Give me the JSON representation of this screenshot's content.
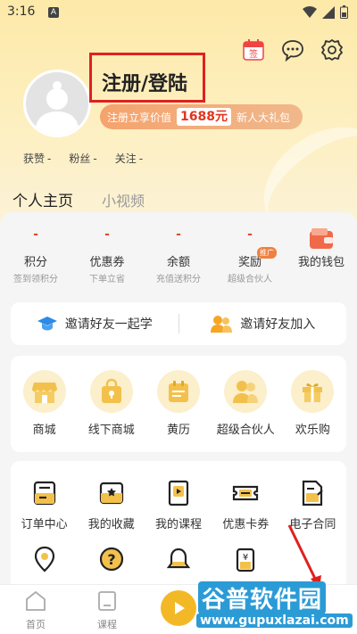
{
  "status_bar": {
    "time": "3:16",
    "notif_letter": "A"
  },
  "header": {
    "calendar_badge": "签",
    "login_title": "注册/登陆",
    "promo": {
      "prefix": "注册立享价值",
      "amount": "1688元",
      "suffix": "新人大礼包"
    },
    "stats": [
      {
        "label": "获赞",
        "value": "-"
      },
      {
        "label": "粉丝",
        "value": "-"
      },
      {
        "label": "关注",
        "value": "-"
      }
    ]
  },
  "tabs": [
    {
      "label": "个人主页"
    },
    {
      "label": "小视频"
    }
  ],
  "wallet": [
    {
      "value": "-",
      "label": "积分",
      "sub": "签到领积分"
    },
    {
      "value": "-",
      "label": "优惠券",
      "sub": "下单立省"
    },
    {
      "value": "-",
      "label": "余额",
      "sub": "充值送积分"
    },
    {
      "value": "-",
      "label": "奖励",
      "sub": "超级合伙人",
      "badge": "推广"
    },
    {
      "value": "",
      "label": "我的钱包",
      "sub": ""
    }
  ],
  "invite": [
    {
      "label": "邀请好友一起学",
      "icon": "graduation-cap-icon"
    },
    {
      "label": "邀请好友加入",
      "icon": "people-icon"
    }
  ],
  "services": [
    {
      "label": "商城",
      "icon": "store-icon"
    },
    {
      "label": "线下商城",
      "icon": "lock-bag-icon"
    },
    {
      "label": "黄历",
      "icon": "calendar-icon"
    },
    {
      "label": "超级合伙人",
      "icon": "partners-icon"
    },
    {
      "label": "欢乐购",
      "icon": "gift-icon"
    }
  ],
  "tools": [
    {
      "label": "订单中心",
      "icon": "order-icon"
    },
    {
      "label": "我的收藏",
      "icon": "favorite-icon"
    },
    {
      "label": "我的课程",
      "icon": "course-icon"
    },
    {
      "label": "优惠卡券",
      "icon": "coupon-icon"
    },
    {
      "label": "电子合同",
      "icon": "contract-icon"
    }
  ],
  "bottom_nav": [
    {
      "label": "首页"
    },
    {
      "label": "课程"
    }
  ],
  "watermark": {
    "title": "谷普软件园",
    "url": "www.gupuxlazai.com"
  },
  "colors": {
    "accent": "#f3b825",
    "red": "#e24a2a",
    "header": "#fde9a8"
  }
}
